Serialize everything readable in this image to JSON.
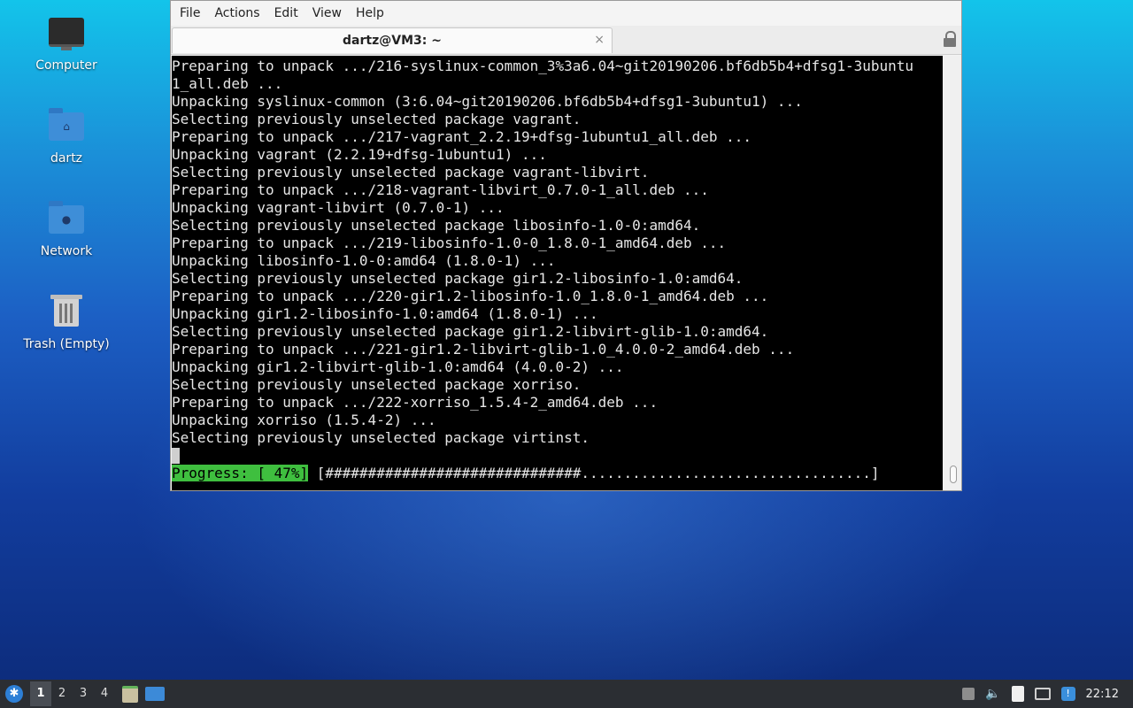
{
  "desktop": {
    "icons": [
      {
        "label": "Computer"
      },
      {
        "label": "dartz"
      },
      {
        "label": "Network"
      },
      {
        "label": "Trash (Empty)"
      }
    ]
  },
  "terminal_window": {
    "menu": [
      "File",
      "Actions",
      "Edit",
      "View",
      "Help"
    ],
    "tab_title": "dartz@VM3: ~",
    "tab_close_symbol": "×",
    "lines": [
      "Preparing to unpack .../216-syslinux-common_3%3a6.04~git20190206.bf6db5b4+dfsg1-3ubuntu",
      "1_all.deb ...",
      "Unpacking syslinux-common (3:6.04~git20190206.bf6db5b4+dfsg1-3ubuntu1) ...",
      "Selecting previously unselected package vagrant.",
      "Preparing to unpack .../217-vagrant_2.2.19+dfsg-1ubuntu1_all.deb ...",
      "Unpacking vagrant (2.2.19+dfsg-1ubuntu1) ...",
      "Selecting previously unselected package vagrant-libvirt.",
      "Preparing to unpack .../218-vagrant-libvirt_0.7.0-1_all.deb ...",
      "Unpacking vagrant-libvirt (0.7.0-1) ...",
      "Selecting previously unselected package libosinfo-1.0-0:amd64.",
      "Preparing to unpack .../219-libosinfo-1.0-0_1.8.0-1_amd64.deb ...",
      "Unpacking libosinfo-1.0-0:amd64 (1.8.0-1) ...",
      "Selecting previously unselected package gir1.2-libosinfo-1.0:amd64.",
      "Preparing to unpack .../220-gir1.2-libosinfo-1.0_1.8.0-1_amd64.deb ...",
      "Unpacking gir1.2-libosinfo-1.0:amd64 (1.8.0-1) ...",
      "Selecting previously unselected package gir1.2-libvirt-glib-1.0:amd64.",
      "Preparing to unpack .../221-gir1.2-libvirt-glib-1.0_4.0.0-2_amd64.deb ...",
      "Unpacking gir1.2-libvirt-glib-1.0:amd64 (4.0.0-2) ...",
      "Selecting previously unselected package xorriso.",
      "Preparing to unpack .../222-xorriso_1.5.4-2_amd64.deb ...",
      "Unpacking xorriso (1.5.4-2) ...",
      "Selecting previously unselected package virtinst."
    ],
    "progress": {
      "label": "Progress: [ 47%]",
      "percent": 47,
      "bar": " [##############################..................................]"
    }
  },
  "taskbar": {
    "workspaces": [
      "1",
      "2",
      "3",
      "4"
    ],
    "active_workspace": "1",
    "clock": "22:12"
  },
  "colors": {
    "progress_green": "#3fbf3f",
    "terminal_bg": "#000000",
    "taskbar_bg": "#2b2e33"
  }
}
